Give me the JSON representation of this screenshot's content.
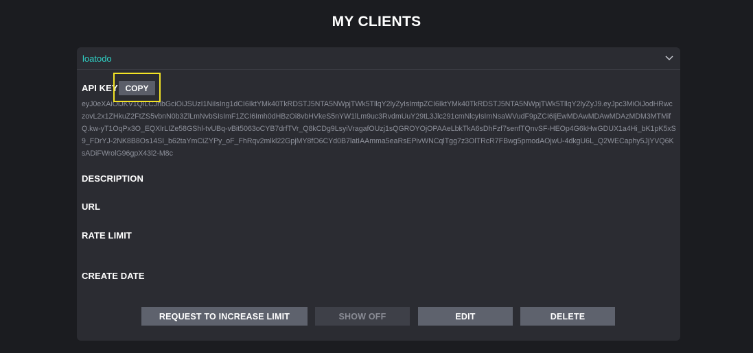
{
  "page": {
    "title": "MY CLIENTS"
  },
  "client": {
    "name": "loatodo",
    "api_key": {
      "label": "API KEY",
      "copy_label": "COPY",
      "value": "eyJ0eXAiOiJKV1QiLCJhbGciOiJSUzI1NiIsIng1dCI6IktYMk40TkRDSTJ5NTA5NWpjTWk5TllqY2lyZyIsImtpZCI6IktYMk40TkRDSTJ5NTA5NWpjTWk5TllqY2lyZyJ9.eyJpc3MiOiJodHRwczovL2x1ZHkuZ2FtZS5vbnN0b3ZlLmNvbSIsImF1ZCI6Imh0dHBzOi8vbHVkeS5nYW1lLm9uc3RvdmUuY29tL3Jlc291cmNlcyIsImNsaWVudF9pZCI6IjEwMDAwMDAwMDAzMDM3MTMifQ.kw-yT1OqPx3O_EQXlrLIZe58GShl-tvUBq-vBit5063oCYB7drfTVr_Q8kCDg9LsyiVragafOUzj1sQGROYOjOPAAeLbkTkA6sDhFzf7senfTQnvSF-HEOp4G6kHwGDUX1a4Hi_bK1pK5xS9_FDrYJ-2NK8B8Os14SI_b62taYmCiZYPy_oF_FhRqv2mlkl22GpjMY8fO6CYd0B7latIAAmma5eaRsEPivWNCqlTgg7z3OlTRcR7FBwg5pmodAOjwU-4dkgU6L_Q2WECaphy5JjYVQ6KsADiFWrolG96gpX43l2-M8c"
    },
    "description": {
      "label": "DESCRIPTION"
    },
    "url": {
      "label": "URL"
    },
    "rate_limit": {
      "label": "RATE LIMIT"
    },
    "create_date": {
      "label": "CREATE DATE"
    }
  },
  "actions": {
    "request_increase": "REQUEST TO INCREASE LIMIT",
    "show_off": "SHOW OFF",
    "edit": "EDIT",
    "delete": "DELETE"
  },
  "colors": {
    "background": "#1b1c20",
    "card": "#2b2c32",
    "accent": "#2fd1c5",
    "highlight": "#f4e425",
    "button": "#5e626d"
  },
  "icons": {
    "expand": "chevron-down-icon"
  }
}
